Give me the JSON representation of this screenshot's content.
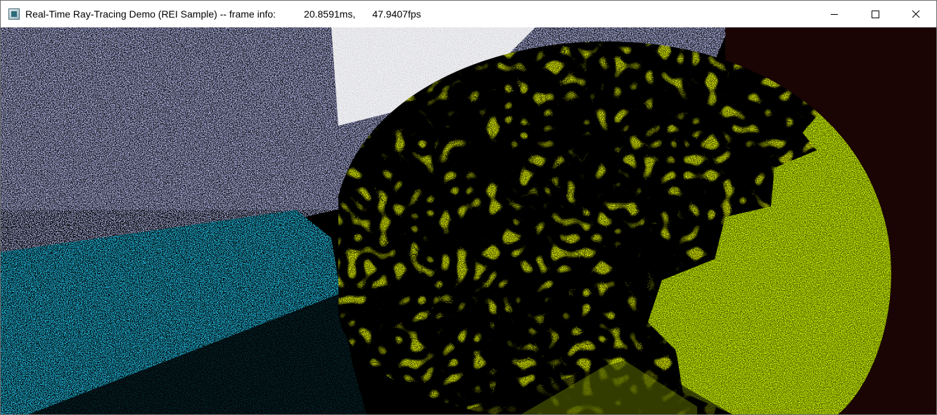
{
  "window": {
    "title": "Real-Time Ray-Tracing Demo (REI Sample) -- frame info:",
    "frame_time": "20.8591ms,",
    "fps": "47.9407fps"
  },
  "controls": {
    "minimize_icon": "minimize-icon",
    "maximize_icon": "maximize-icon",
    "close_icon": "close-icon"
  },
  "scene": {
    "colors": {
      "sky": "#a7acd8",
      "cyan_surface": "#1fb3d6",
      "green_sphere": "#c9f000",
      "white_speckle": "#ffffff",
      "dark_red_wall": "#1a0404"
    }
  }
}
